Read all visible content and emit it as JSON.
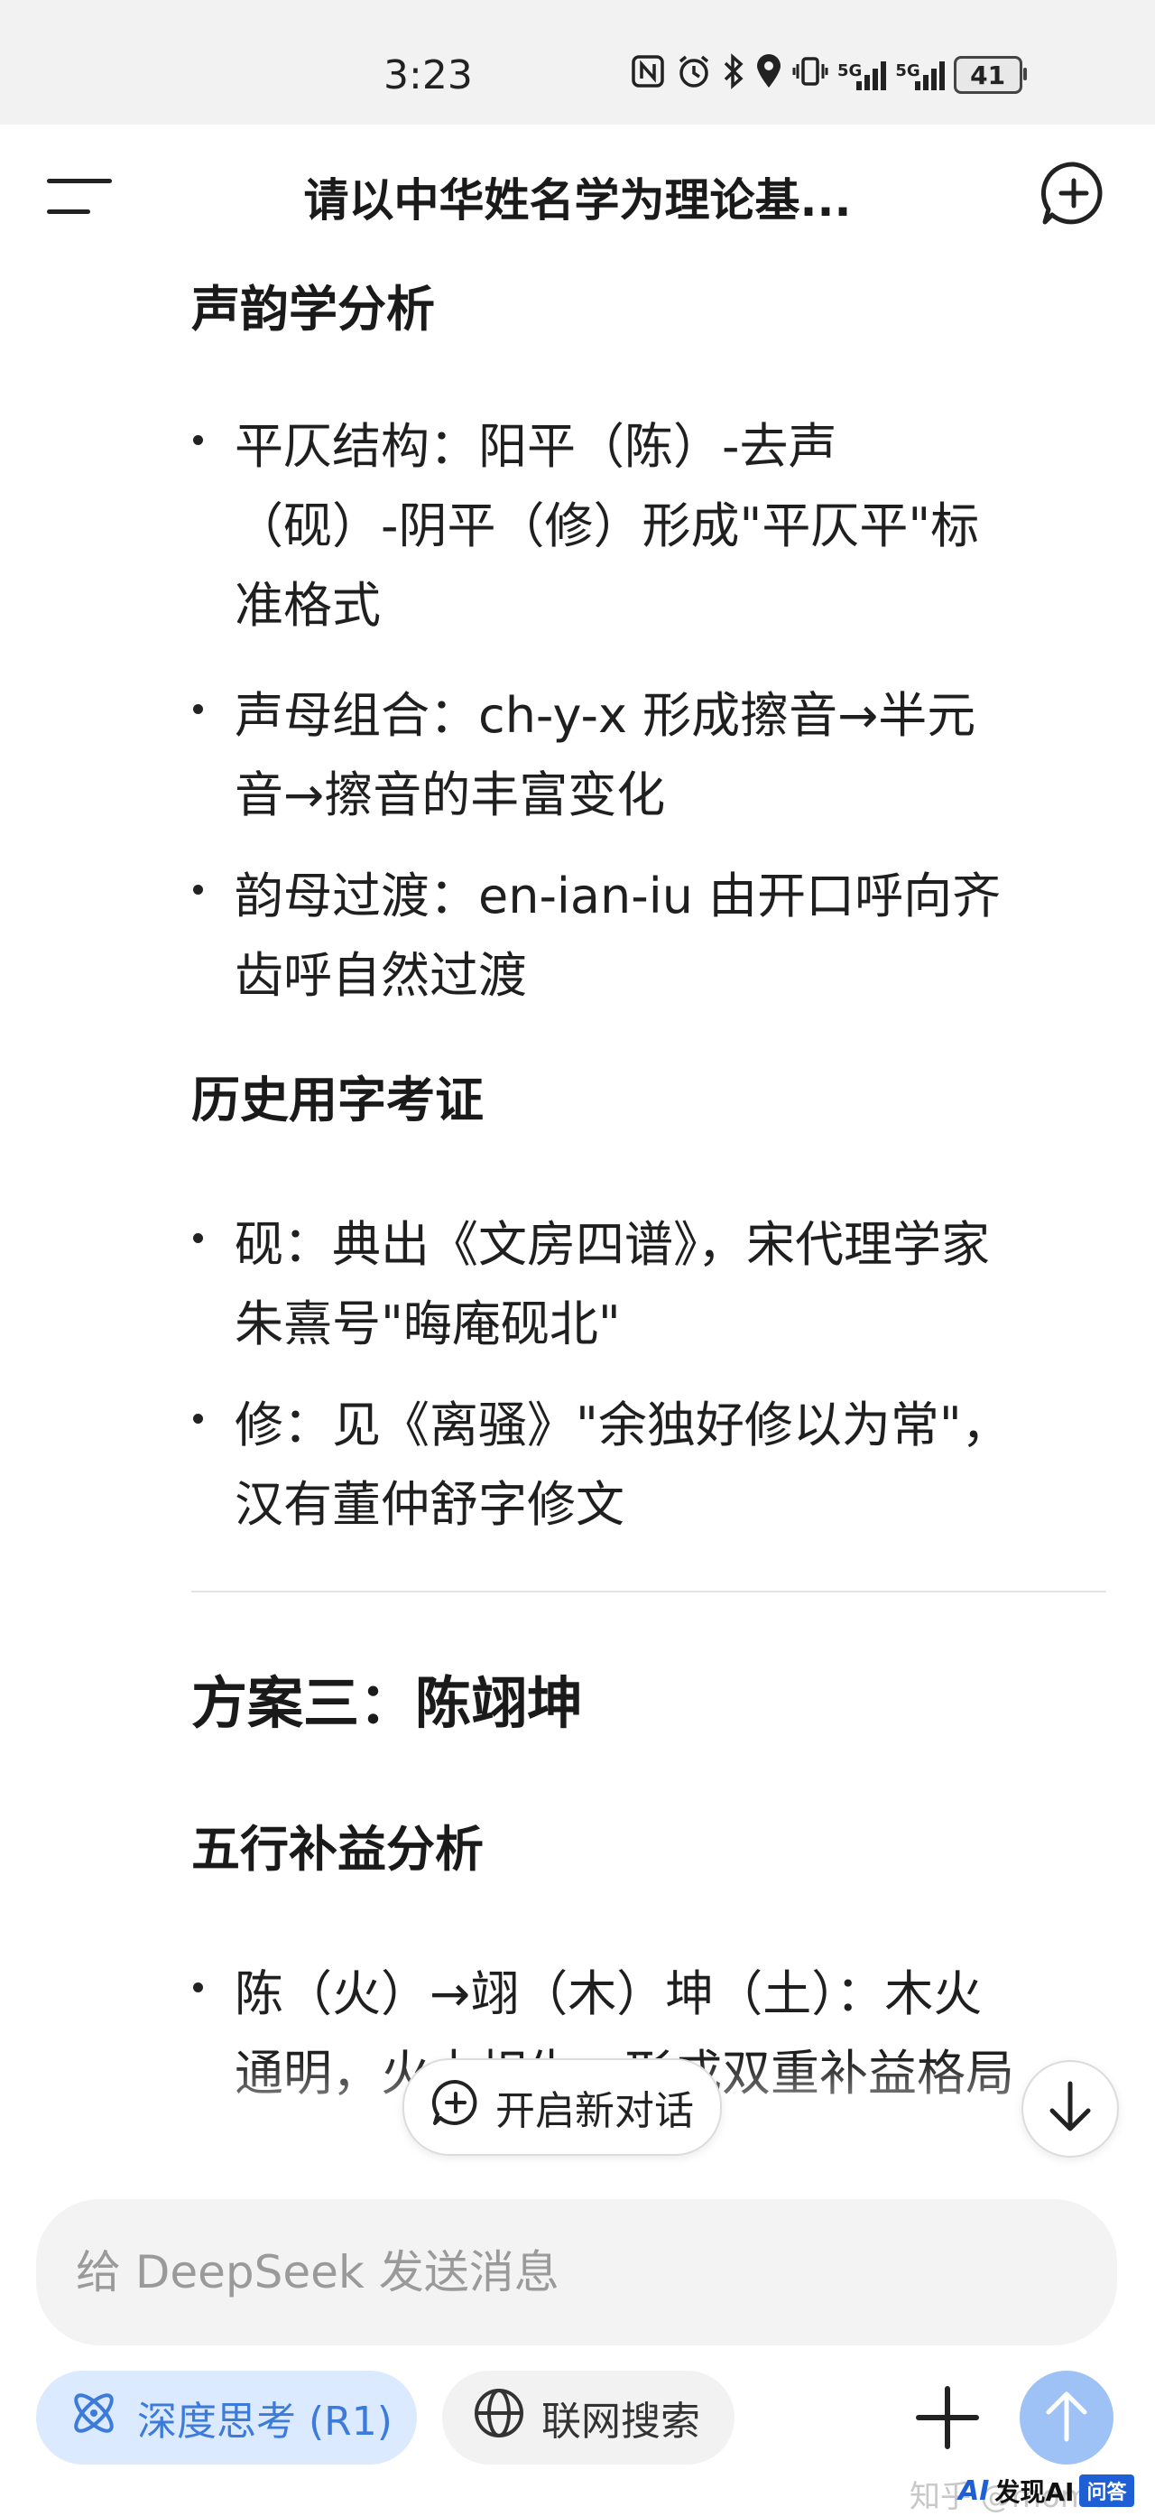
{
  "status": {
    "time": "3:23",
    "signal_label_1": "5G",
    "signal_label_2": "5G",
    "battery": "41"
  },
  "header": {
    "title": "请以中华姓名学为理论基..."
  },
  "content": {
    "section_phonology": "声韵学分析",
    "phonology_item1_line1": "平仄结构：阳平（陈）-去声",
    "phonology_item1_line2": "（砚）-阴平（修）形成\"平仄平\"标",
    "phonology_item1_line3": "准格式",
    "phonology_item2_line1": "声母组合：ch-y-x 形成擦音→半元",
    "phonology_item2_line2": "音→擦音的丰富变化",
    "phonology_item3_line1": "韵母过渡：en-ian-iu 由开口呼向齐",
    "phonology_item3_line2": "齿呼自然过渡",
    "section_history": "历史用字考证",
    "history_item1_line1": "砚：典出《文房四谱》，宋代理学家",
    "history_item1_line2": "朱熹号\"晦庵砚北\"",
    "history_item2_line1": "修：见《离骚》\"余独好修以为常\"，",
    "history_item2_line2": "汉有董仲舒字修文",
    "plan3_title": "方案三：陈翊坤",
    "section_wuxing": "五行补益分析",
    "wuxing_item1_line1": "陈（火）→翊（木）坤（土）：木火",
    "wuxing_item1_line2": "通明，火土相生，形成双重补益格局"
  },
  "floating": {
    "new_chat_label": "开启新对话"
  },
  "composer": {
    "placeholder": "给 DeepSeek 发送消息",
    "deep_think_label": "深度思考 (R1)",
    "web_search_label": "联网搜索"
  },
  "watermark": {
    "text": "知乎 @momo",
    "logo_ai": "AI",
    "logo_name": "发现AI",
    "logo_badge": "问答"
  },
  "colors": {
    "accent": "#3d7bdb",
    "accent_bg": "#dbeafe",
    "send_button": "#9ec2f5"
  }
}
